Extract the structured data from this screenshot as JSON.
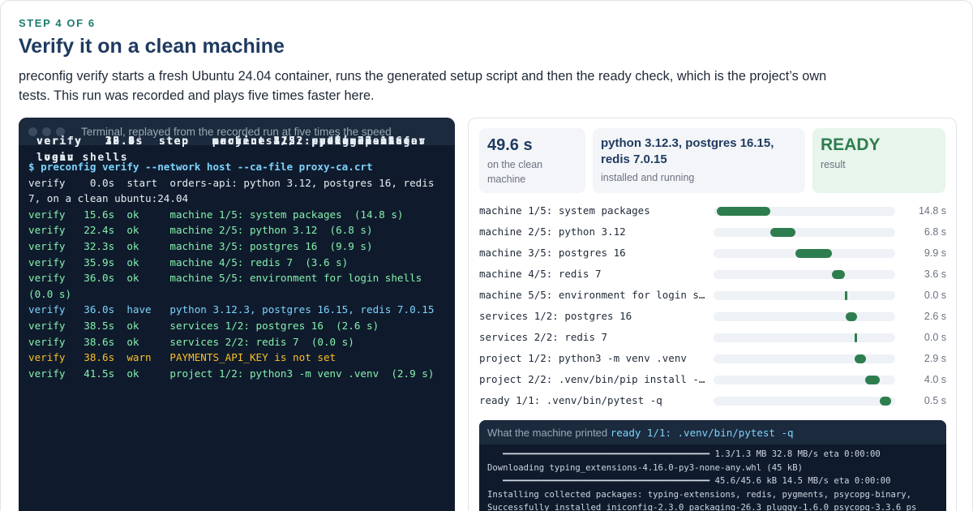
{
  "header": {
    "step": "STEP 4 OF 6",
    "title": "Verify it on a clean machine",
    "description": "preconfig verify starts a fresh Ubuntu 24.04 container, runs the generated setup script and then the ready check, which is the project’s own tests. This run was recorded and plays five times faster here."
  },
  "terminal": {
    "title": "Terminal, replayed from the recorded run at five times the speed",
    "lines": [
      {
        "kind": "cmd",
        "text": "$ preconfig verify --network host --ca-file proxy-ca.crt"
      },
      {
        "kind": "start",
        "text": "verify    0.0s  start  orders-api: python 3.12, postgres 16, redis 7, on a clean ubuntu:24.04"
      },
      {
        "kind": "step",
        "text": "verify    0.8s  step   machine 1/5: system packages"
      },
      {
        "kind": "ok",
        "text": "verify   15.6s  ok     machine 1/5: system packages  (14.8 s)"
      },
      {
        "kind": "step",
        "text": "verify   15.6s  step   machine 2/5: python 3.12"
      },
      {
        "kind": "ok",
        "text": "verify   22.4s  ok     machine 2/5: python 3.12  (6.8 s)"
      },
      {
        "kind": "step",
        "text": "verify   22.4s  step   machine 3/5: postgres 16"
      },
      {
        "kind": "ok",
        "text": "verify   32.3s  ok     machine 3/5: postgres 16  (9.9 s)"
      },
      {
        "kind": "step",
        "text": "verify   32.3s  step   machine 4/5: redis 7"
      },
      {
        "kind": "ok",
        "text": "verify   35.9s  ok     machine 4/5: redis 7  (3.6 s)"
      },
      {
        "kind": "step",
        "text": "verify   35.9s  step   machine 5/5: environment for login shells"
      },
      {
        "kind": "ok",
        "text": "verify   36.0s  ok     machine 5/5: environment for login shells (0.0 s)"
      },
      {
        "kind": "have",
        "text": "verify   36.0s  have   python 3.12.3, postgres 16.15, redis 7.0.15"
      },
      {
        "kind": "step",
        "text": "verify   36.0s  step   services 1/2: postgres 16"
      },
      {
        "kind": "ok",
        "text": "verify   38.5s  ok     services 1/2: postgres 16  (2.6 s)"
      },
      {
        "kind": "step",
        "text": "verify   38.5s  step   services 2/2: redis 7"
      },
      {
        "kind": "ok",
        "text": "verify   38.6s  ok     services 2/2: redis 7  (0.0 s)"
      },
      {
        "kind": "warn",
        "text": "verify   38.6s  warn   PAYMENTS_API_KEY is not set"
      },
      {
        "kind": "step",
        "text": "verify   38.6s  step   project 1/2: python3 -m venv .venv"
      },
      {
        "kind": "ok",
        "text": "verify   41.5s  ok     project 1/2: python3 -m venv .venv  (2.9 s)"
      }
    ]
  },
  "summary": {
    "duration_value": "49.6 s",
    "duration_label": "on the clean machine",
    "versions_value": "python 3.12.3, postgres 16.15, redis 7.0.15",
    "versions_label": "installed and running",
    "result_value": "READY",
    "result_label": "result"
  },
  "timeline": {
    "total_seconds": 49.6,
    "rows": [
      {
        "label": "machine 1/5: system packages",
        "start": 0.8,
        "duration": 14.8,
        "value": "14.8 s"
      },
      {
        "label": "machine 2/5: python 3.12",
        "start": 15.6,
        "duration": 6.8,
        "value": "6.8 s"
      },
      {
        "label": "machine 3/5: postgres 16",
        "start": 22.4,
        "duration": 9.9,
        "value": "9.9 s"
      },
      {
        "label": "machine 4/5: redis 7",
        "start": 32.3,
        "duration": 3.6,
        "value": "3.6 s"
      },
      {
        "label": "machine 5/5: environment for login s…",
        "start": 35.9,
        "duration": 0.0,
        "value": "0.0 s"
      },
      {
        "label": "services 1/2: postgres 16",
        "start": 36.0,
        "duration": 2.6,
        "value": "2.6 s"
      },
      {
        "label": "services 2/2: redis 7",
        "start": 38.5,
        "duration": 0.0,
        "value": "0.0 s"
      },
      {
        "label": "project 1/2: python3 -m venv .venv",
        "start": 38.6,
        "duration": 2.9,
        "value": "2.9 s"
      },
      {
        "label": "project 2/2: .venv/bin/pip install -…",
        "start": 41.5,
        "duration": 4.0,
        "value": "4.0 s"
      },
      {
        "label": "ready 1/1: .venv/bin/pytest -q",
        "start": 45.5,
        "duration": 0.5,
        "value": "0.5 s"
      }
    ]
  },
  "output": {
    "prefix": "What the machine printed ",
    "command": "ready 1/1: .venv/bin/pytest -q",
    "lines": [
      "   ━━━━━━━━━━━━━━━━━━━━━━━━━━━━━━━━━━━━━━━━ 1.3/1.3 MB 32.8 MB/s eta 0:00:00",
      "Downloading typing_extensions-4.16.0-py3-none-any.whl (45 kB)",
      "   ━━━━━━━━━━━━━━━━━━━━━━━━━━━━━━━━━━━━━━━━ 45.6/45.6 kB 14.5 MB/s eta 0:00:00",
      "Installing collected packages: typing-extensions, redis, pygments, psycopg-binary,",
      "Successfully installed iniconfig-2.3.0 packaging-26.3 pluggy-1.6.0 psycopg-3.3.6 ps"
    ]
  },
  "colors": {
    "accent_green": "#2e7d4f",
    "terminal_bg": "#0f1b2d",
    "title_navy": "#1e3a5f"
  }
}
